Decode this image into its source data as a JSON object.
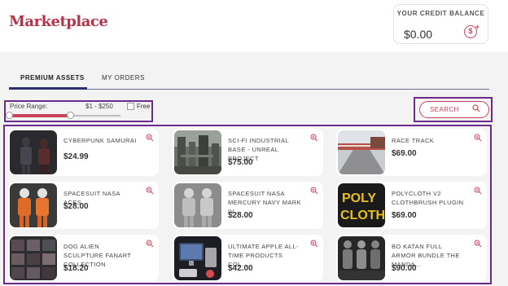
{
  "header": {
    "brand": "Marketplace",
    "credit": {
      "title": "YOUR CREDIT BALANCE",
      "amount": "$0.00",
      "add_icon": "dollar-plus-icon"
    }
  },
  "tabs": [
    {
      "label": "PREMIUM ASSETS",
      "active": true
    },
    {
      "label": "MY ORDERS",
      "active": false
    }
  ],
  "filter": {
    "price_label": "Price Range:",
    "price_range": "$1 - $250",
    "slider_fill_fraction": 0.55,
    "free_label": "Free",
    "free_checked": false
  },
  "search": {
    "label": "SEARCH",
    "icon": "search-icon"
  },
  "assets": [
    {
      "name": "CYBERPUNK SAMURAI",
      "price": "$24.99",
      "thumb": "dark-figure"
    },
    {
      "name": "SCI-FI INDUSTRIAL BASE - UNREAL PROJECT",
      "price": "$75.00",
      "thumb": "industrial"
    },
    {
      "name": "RACE TRACK",
      "price": "$69.00",
      "thumb": "track"
    },
    {
      "name": "SPACESUIT NASA ACES",
      "price": "$28.00",
      "thumb": "orange-suits"
    },
    {
      "name": "SPACESUIT NASA MERCURY NAVY MARK IV",
      "price": "$28.00",
      "thumb": "grey-suits"
    },
    {
      "name": "POLYCLOTH V2 CLOTHBRUSH PLUGIN ...",
      "price": "$69.00",
      "thumb": "polycloth",
      "thumb_text": [
        "POLY",
        "CLOTH"
      ]
    },
    {
      "name": "DOG ALIEN SCULPTURE FANART COLLECTION",
      "price": "$18.20",
      "thumb": "alien"
    },
    {
      "name": "ULTIMATE APPLE ALL-TIME PRODUCTS COL...",
      "price": "$42.00",
      "thumb": "apple"
    },
    {
      "name": "BO KATAN FULL ARMOR BUNDLE THE MANDA...",
      "price": "$90.00",
      "thumb": "armor"
    }
  ],
  "colors": {
    "accent": "#c9455e",
    "brand": "#b8314a",
    "highlight_box": "#6c2a8a",
    "tab_underline": "#2b2f6b"
  }
}
